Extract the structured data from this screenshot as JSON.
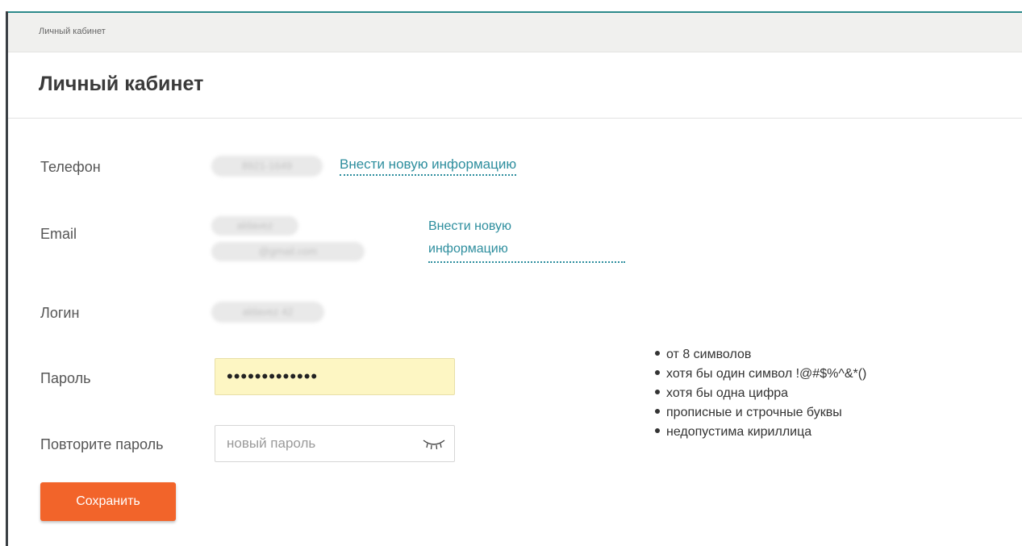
{
  "breadcrumb": "Личный кабинет",
  "page_title": "Личный кабинет",
  "fields": {
    "phone": {
      "label": "Телефон",
      "value_blurred": "8921-1649",
      "link": "Внести новую информацию"
    },
    "email": {
      "label": "Email",
      "value_blurred_line1": "aldavez",
      "value_blurred_line2": "@gmail.com",
      "link_line1": "Внести новую",
      "link_line2": "информацию"
    },
    "login": {
      "label": "Логин",
      "value_blurred": "aldavez 42"
    },
    "password": {
      "label": "Пароль",
      "value": "•••••••••••••"
    },
    "repeat_password": {
      "label": "Повторите пароль",
      "placeholder": "новый пароль",
      "icon": "eye-closed-icon"
    }
  },
  "password_rules": [
    "от 8 символов",
    "хотя бы один символ !@#$%^&*()",
    "хотя бы одна цифра",
    "прописные и строчные буквы",
    "недопустима кириллица"
  ],
  "save_button": "Сохранить",
  "colors": {
    "accent": "#f2642a",
    "link": "#2e8e9e",
    "password_bg": "#fdf6c3"
  }
}
